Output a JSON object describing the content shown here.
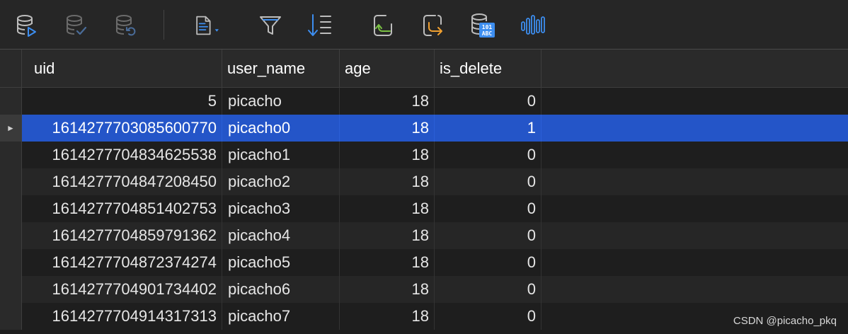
{
  "toolbar": {
    "icons": [
      "database-run-icon",
      "database-commit-icon",
      "database-rollback-icon",
      "document-menu-icon",
      "filter-icon",
      "sort-icon",
      "import-icon",
      "export-icon",
      "database-text-icon",
      "waveform-icon"
    ],
    "colors": {
      "disabled": "#6b6b6b",
      "normal": "#bdbdbd",
      "accent_blue": "#3d8ef0",
      "green": "#7ac143",
      "orange": "#f0a030"
    }
  },
  "table": {
    "columns": [
      "uid",
      "user_name",
      "age",
      "is_delete"
    ],
    "selected_row_index": 1,
    "selected_row_marker": "►",
    "rows": [
      {
        "uid": "5",
        "user_name": "picacho",
        "age": "18",
        "is_delete": "0"
      },
      {
        "uid": "1614277703085600770",
        "user_name": "picacho0",
        "age": "18",
        "is_delete": "1"
      },
      {
        "uid": "1614277704834625538",
        "user_name": "picacho1",
        "age": "18",
        "is_delete": "0"
      },
      {
        "uid": "1614277704847208450",
        "user_name": "picacho2",
        "age": "18",
        "is_delete": "0"
      },
      {
        "uid": "1614277704851402753",
        "user_name": "picacho3",
        "age": "18",
        "is_delete": "0"
      },
      {
        "uid": "1614277704859791362",
        "user_name": "picacho4",
        "age": "18",
        "is_delete": "0"
      },
      {
        "uid": "1614277704872374274",
        "user_name": "picacho5",
        "age": "18",
        "is_delete": "0"
      },
      {
        "uid": "1614277704901734402",
        "user_name": "picacho6",
        "age": "18",
        "is_delete": "0"
      },
      {
        "uid": "1614277704914317313",
        "user_name": "picacho7",
        "age": "18",
        "is_delete": "0"
      }
    ],
    "colors": {
      "selection": "#2455c8",
      "row_odd": "#1e1e1e",
      "row_even": "#262626"
    }
  },
  "watermark": "CSDN @picacho_pkq"
}
